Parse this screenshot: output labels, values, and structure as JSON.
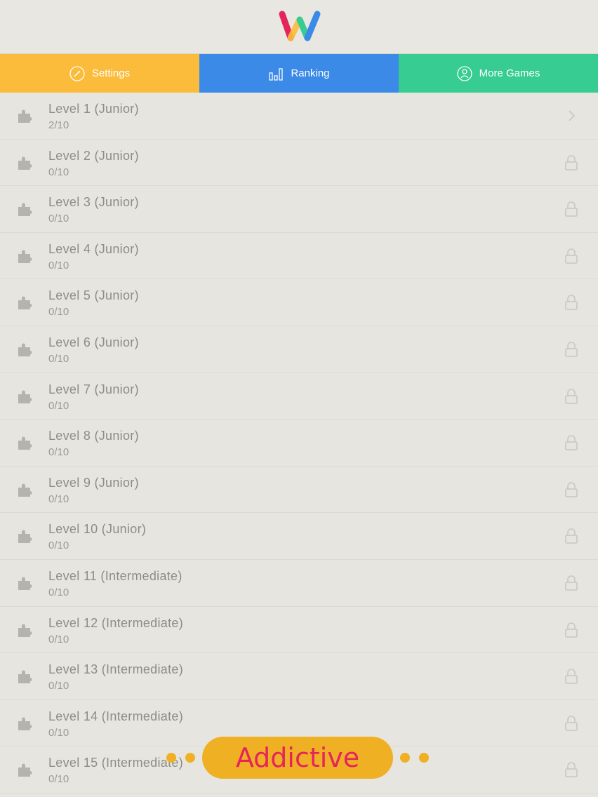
{
  "header": {
    "logo": "W",
    "logo_colors": [
      "#e5245c",
      "#36cc92",
      "#3b8ae8"
    ]
  },
  "tabs": [
    {
      "label": "Settings",
      "icon": "settings-icon",
      "color": "#fbbc3c"
    },
    {
      "label": "Ranking",
      "icon": "bar-chart-icon",
      "color": "#3b8ae8"
    },
    {
      "label": "More Games",
      "icon": "person-icon",
      "color": "#36cc92"
    }
  ],
  "levels": [
    {
      "title": "Level 1 (Junior)",
      "progress": "2/10",
      "state": "chevron-right-icon"
    },
    {
      "title": "Level 2 (Junior)",
      "progress": "0/10",
      "state": "lock-icon"
    },
    {
      "title": "Level 3 (Junior)",
      "progress": "0/10",
      "state": "lock-icon"
    },
    {
      "title": "Level 4 (Junior)",
      "progress": "0/10",
      "state": "lock-icon"
    },
    {
      "title": "Level 5 (Junior)",
      "progress": "0/10",
      "state": "lock-icon"
    },
    {
      "title": "Level 6 (Junior)",
      "progress": "0/10",
      "state": "lock-icon"
    },
    {
      "title": "Level 7 (Junior)",
      "progress": "0/10",
      "state": "lock-icon"
    },
    {
      "title": "Level 8 (Junior)",
      "progress": "0/10",
      "state": "lock-icon"
    },
    {
      "title": "Level 9 (Junior)",
      "progress": "0/10",
      "state": "lock-icon"
    },
    {
      "title": "Level 10 (Junior)",
      "progress": "0/10",
      "state": "lock-icon"
    },
    {
      "title": "Level 11 (Intermediate)",
      "progress": "0/10",
      "state": "lock-icon"
    },
    {
      "title": "Level 12 (Intermediate)",
      "progress": "0/10",
      "state": "lock-icon"
    },
    {
      "title": "Level 13 (Intermediate)",
      "progress": "0/10",
      "state": "lock-icon"
    },
    {
      "title": "Level 14 (Intermediate)",
      "progress": "0/10",
      "state": "lock-icon"
    },
    {
      "title": "Level 15 (Intermediate)",
      "progress": "0/10",
      "state": "lock-icon"
    }
  ],
  "banner": {
    "text": "Addictive",
    "background": "#f0b024",
    "text_color": "#e5245c"
  }
}
